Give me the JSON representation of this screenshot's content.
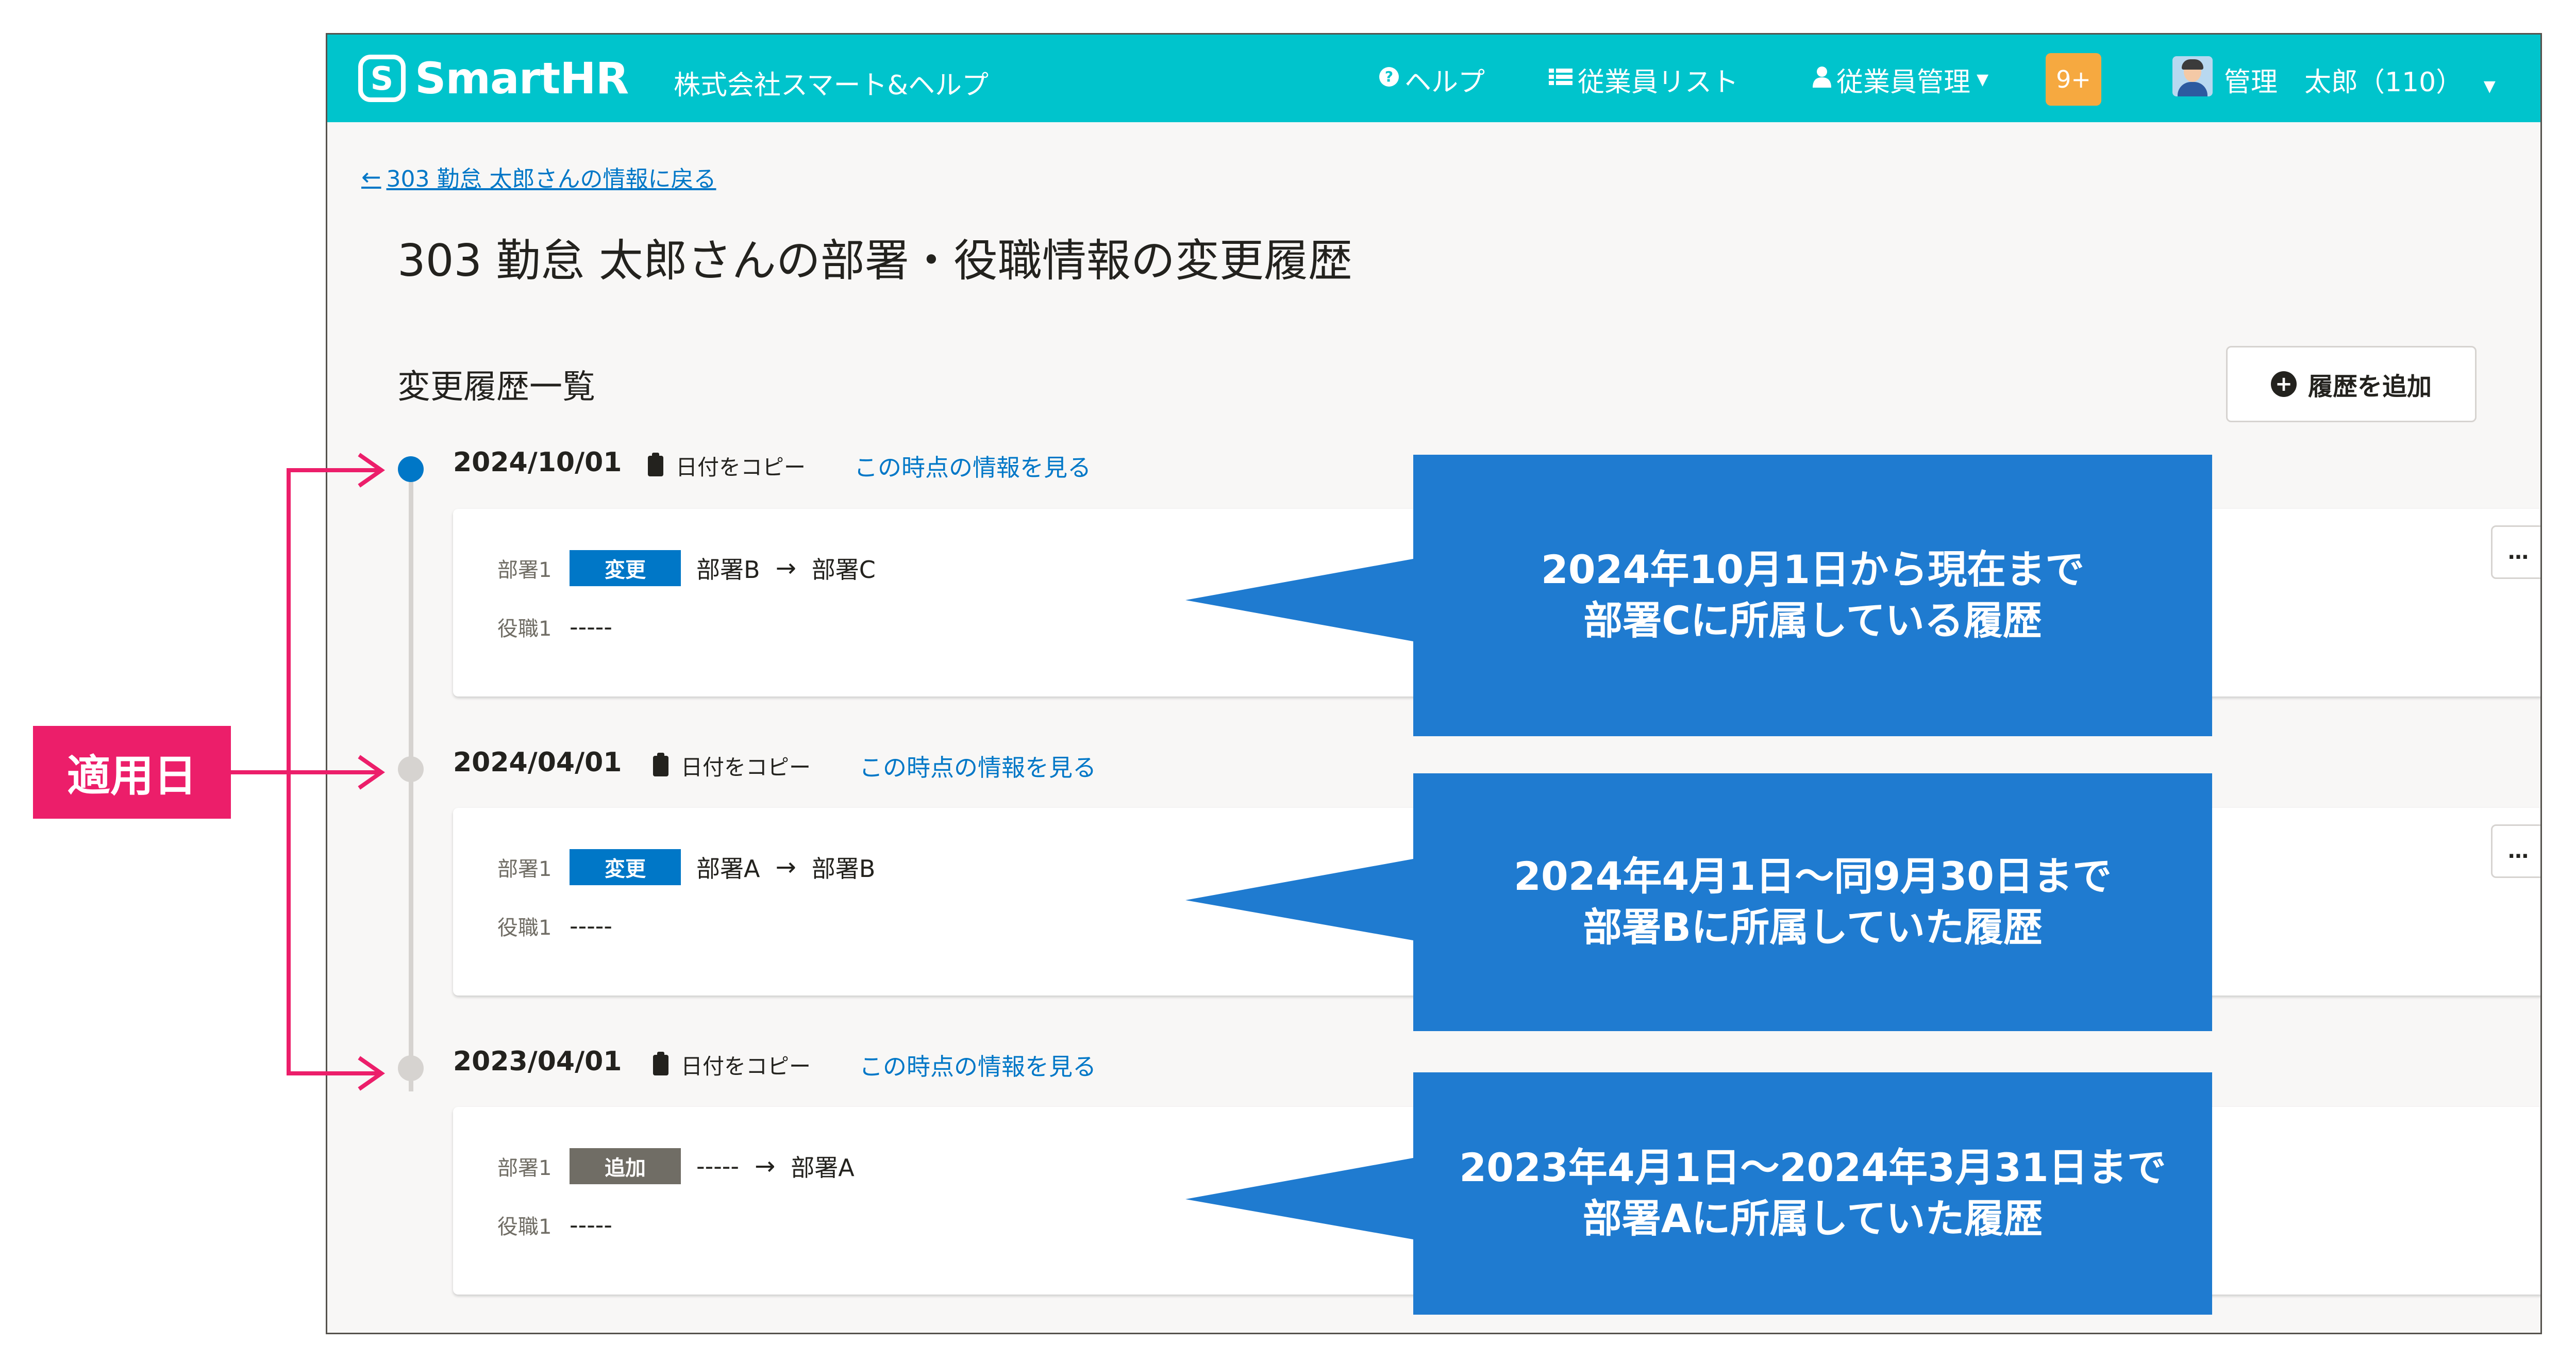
{
  "header": {
    "logo_mark": "S",
    "logo_text": "SmartHR",
    "company": "株式会社スマート&ヘルプ",
    "nav": [
      {
        "icon": "help-icon",
        "label": "ヘルプ"
      },
      {
        "icon": "list-icon",
        "label": "従業員リスト"
      },
      {
        "icon": "person-icon",
        "label": "従業員管理"
      }
    ],
    "notifications": "9+",
    "user": "管理　太郎（110）"
  },
  "page": {
    "back_link": "303 勤怠 太郎さんの情報に戻る",
    "title": "303 勤怠 太郎さんの部署・役職情報の変更履歴",
    "section_title": "変更履歴一覧",
    "add_button": "履歴を追加",
    "copy_label": "日付をコピー",
    "view_label": "この時点の情報を見る",
    "dept_label": "部署1",
    "role_label": "役職1",
    "more_label": "…"
  },
  "history": [
    {
      "date": "2024/10/01",
      "tag": "変更",
      "from": "部署B",
      "to": "部署C",
      "role": "-----"
    },
    {
      "date": "2024/04/01",
      "tag": "変更",
      "from": "部署A",
      "to": "部署B",
      "role": "-----"
    },
    {
      "date": "2023/04/01",
      "tag": "追加",
      "from": "-----",
      "to": "部署A",
      "role": "-----"
    }
  ],
  "annotations": {
    "left_label": "適用日",
    "callouts": [
      {
        "line1": "2024年10月1日から現在まで",
        "line2": "部署Cに所属している履歴"
      },
      {
        "line1": "2024年4月1日〜同9月30日まで",
        "line2": "部署Bに所属していた履歴"
      },
      {
        "line1": "2023年4月1日〜2024年3月31日まで",
        "line2": "部署Aに所属していた履歴"
      }
    ]
  },
  "colors": {
    "header": "#00c4cc",
    "link": "#0077c7",
    "callout": "#1f7bd0",
    "annotation": "#ec1e6a",
    "badge": "#f6a940"
  }
}
